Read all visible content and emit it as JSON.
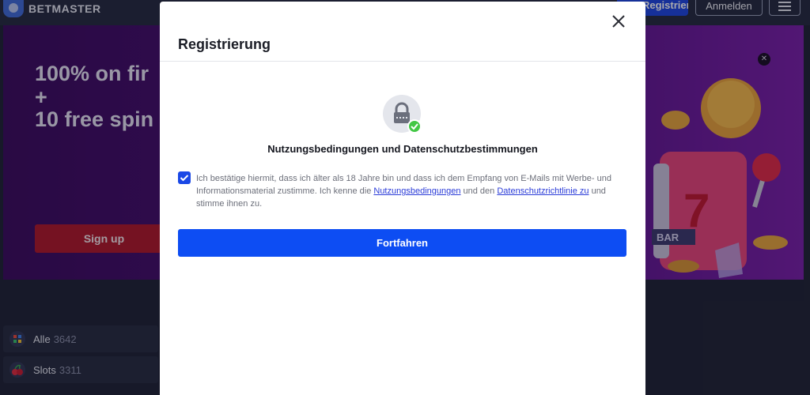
{
  "header": {
    "logo_text": "BETMASTER",
    "register_label": "Registrieren",
    "login_label": "Anmelden"
  },
  "banner": {
    "promo_lines": [
      "100% on fir",
      "+",
      "10 free spin"
    ],
    "signup_label": "Sign up",
    "close_glyph": "✕"
  },
  "categories": [
    {
      "label": "Alle",
      "count": "3642",
      "icon": "grid-icon"
    },
    {
      "label": "Slots",
      "count": "3311",
      "icon": "cherry-icon"
    }
  ],
  "modal": {
    "title": "Registrierung",
    "section_title": "Nutzungsbedingungen und Datenschutzbestimmungen",
    "consent": {
      "text_1": "Ich bestätige hiermit, dass ich älter als 18 Jahre bin und dass ich dem Empfang von E-Mails mit Werbe- und Informationsmaterial zustimme. Ich kenne die ",
      "terms_link": "Nutzungsbedingungen",
      "text_2": " und den ",
      "privacy_link": "Datenschutzrichtlinie zu",
      "text_3": " und stimme ihnen zu.",
      "checked": true
    },
    "continue_label": "Fortfahren"
  },
  "colors": {
    "primary_blue": "#0d4df3",
    "signup_red": "#b0182a",
    "check_green": "#42c744",
    "banner_purple": "#4a0f73"
  }
}
